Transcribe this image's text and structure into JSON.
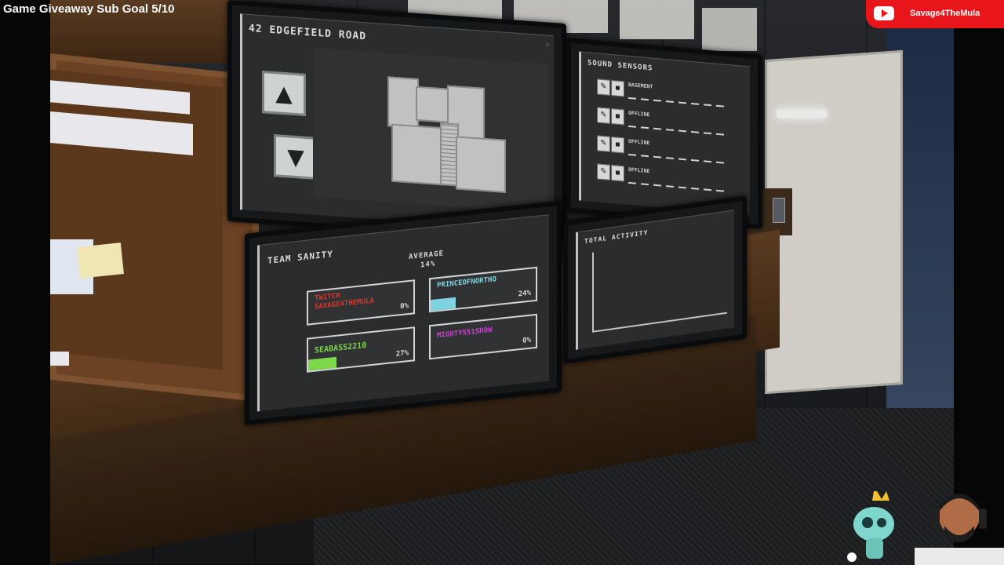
{
  "stream_overlay": {
    "goal_text": "Game Giveaway Sub Goal 5/10",
    "channel_name": "Savage4TheMula",
    "youtube_icon": "youtube-play-icon",
    "mascot_icon": "crowned-cat-mascot",
    "webcam": "streamer-avatar"
  },
  "map_monitor": {
    "title": "42 EDGEFIELD ROAD",
    "up_icon": "▲",
    "down_icon": "▼"
  },
  "sound_monitor": {
    "title": "SOUND SENSORS",
    "sensors": [
      {
        "label": "BASEMENT"
      },
      {
        "label": "OFFLINE"
      },
      {
        "label": "OFFLINE"
      },
      {
        "label": "OFFLINE"
      }
    ]
  },
  "sanity_monitor": {
    "title": "TEAM SANITY",
    "average_label": "AVERAGE",
    "average_value": "14%",
    "players": [
      {
        "name": "TWITCH\nSAVAGE4THEMULA",
        "percent_text": "0%",
        "value": 0,
        "color": "#e0312b"
      },
      {
        "name": "PRINCEOFNORTHO",
        "percent_text": "24%",
        "value": 24,
        "color": "#7fd3e0"
      },
      {
        "name": "SEABASS2210",
        "percent_text": "27%",
        "value": 27,
        "color": "#7ed64a"
      },
      {
        "name": "MIGHTY551SHOW",
        "percent_text": "0%",
        "value": 0,
        "color": "#d23fd6"
      }
    ]
  },
  "activity_monitor": {
    "title": "TOTAL ACTIVITY"
  },
  "colors": {
    "youtube_red": "#e8151b",
    "screen_bg": "#2a2c2d",
    "wood": "#5a3b22"
  }
}
